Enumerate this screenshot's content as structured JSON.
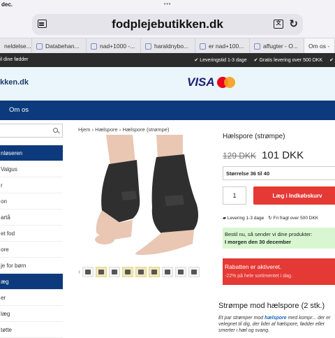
{
  "status_bar": {
    "date": "dec.",
    "dots": "•••"
  },
  "browser": {
    "url": "fodplejebutikken.dk",
    "tabs": [
      {
        "label": "neldelse..."
      },
      {
        "label": "Databehan..."
      },
      {
        "label": "nad+1000 -..."
      },
      {
        "label": "haraldnybo..."
      },
      {
        "label": "er nad+100..."
      },
      {
        "label": "affugter - O..."
      },
      {
        "label": "Om os -"
      }
    ],
    "translate_icon": "translate-icon",
    "reload_icon": "reload-icon"
  },
  "promo": {
    "left": "il dine fødder",
    "items": [
      "Leveringstid 1-3 dage",
      "Gratis levering over 500 DKK"
    ]
  },
  "header": {
    "logo": "kken.dk",
    "visa": "VISA",
    "payment_icon": "mastercard-icon"
  },
  "nav": {
    "item": "Om os"
  },
  "sidebar": {
    "items": [
      {
        "label": "nløseren"
      },
      {
        "label": "Valgus"
      },
      {
        "label": "r"
      },
      {
        "label": "on"
      },
      {
        "label": "artå"
      },
      {
        "label": "et fod"
      },
      {
        "label": "ore"
      },
      {
        "label": "je for børn"
      },
      {
        "label": "æg"
      },
      {
        "label": "er"
      },
      {
        "label": "læg"
      },
      {
        "label": "tøtte"
      }
    ]
  },
  "breadcrumb": "Hjem › Hælspore › Hælspore (strømpe)",
  "product": {
    "title": "Hælspore (strømpe)",
    "old_price": "129 DKK",
    "new_price": "101 DKK",
    "size": "Størrelse 36 til 40",
    "qty": "1",
    "buy_label": "Læg i Indkøbskurv",
    "delivery_1": "Levering 1-3 dage",
    "delivery_2": "Fri fragt over 500 DKK",
    "order_line1": "Bestil nu, så sender vi dine produkter:",
    "order_line2": "I morgen den 30 december",
    "discount_title": "Rabatten er aktiveret.",
    "discount_text": "-22% på hele sortimentet i dag."
  },
  "description": {
    "title": "Strømpe mod hælspore (2 stk.)",
    "text_1": "Et par strømper mod ",
    "text_link": "hælspore",
    "text_2": " med kompr... der er velegnet til dig, der lider af hælspore, fødder eller smerter i hæl og svang."
  },
  "colors": {
    "nav": "#0d3a7c",
    "buy": "#e53935",
    "header_bg": "#eaf6fb",
    "order_bg": "#d8f7d0"
  }
}
